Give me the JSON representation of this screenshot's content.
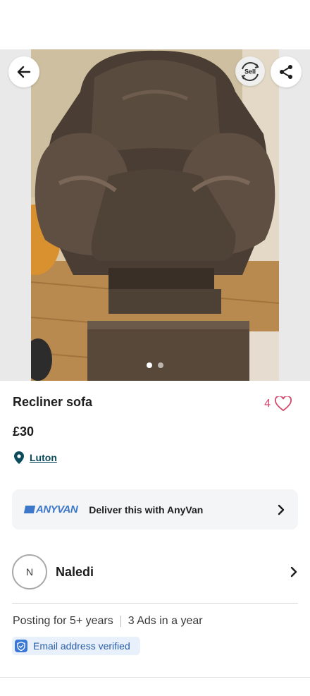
{
  "listing": {
    "title": "Recliner sofa",
    "price": "£30",
    "location": "Luton",
    "favourites_count": "4"
  },
  "header": {
    "sell_label": "Sell"
  },
  "gallery": {
    "image_count": 2,
    "active_index": 0
  },
  "delivery": {
    "brand": "ANYVAN",
    "label": "Deliver this with AnyVan"
  },
  "seller": {
    "initial": "N",
    "name": "Naledi",
    "posting_for": "Posting for 5+ years",
    "ads_per_year": "3 Ads in a year",
    "verified_label": "Email address verified"
  },
  "colors": {
    "accent_teal": "#0c4b5c",
    "favourite_pink": "#d24a6e",
    "anyvan_blue": "#3c77c9",
    "verified_bg": "#e7f0fb"
  },
  "icons": [
    "back-arrow-icon",
    "sell-cycle-icon",
    "share-icon",
    "heart-icon",
    "location-pin-icon",
    "chevron-right-icon",
    "shield-check-icon"
  ]
}
